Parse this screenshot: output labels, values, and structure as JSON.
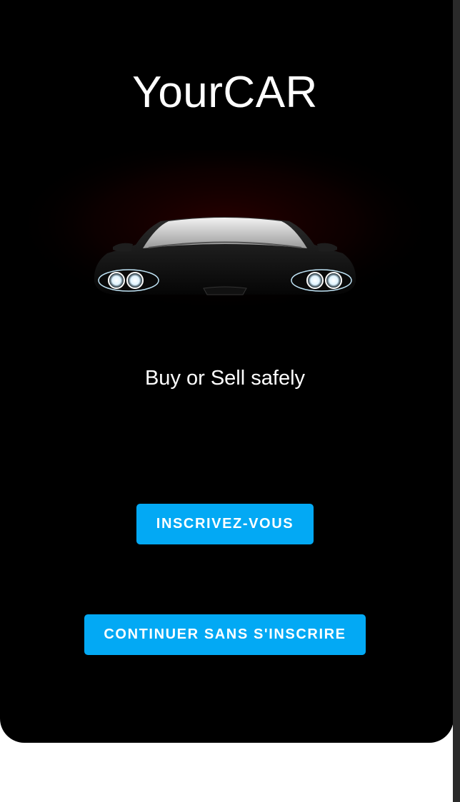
{
  "app": {
    "title": "YourCAR",
    "tagline": "Buy or Sell safely"
  },
  "hero": {
    "icon": "car-front-headlights-image"
  },
  "actions": {
    "register_label": "INSCRIVEZ-VOUS",
    "continue_label": "CONTINUER SANS S'INSCRIRE"
  },
  "colors": {
    "background": "#000000",
    "accent": "#03a9f4",
    "text": "#ffffff"
  }
}
